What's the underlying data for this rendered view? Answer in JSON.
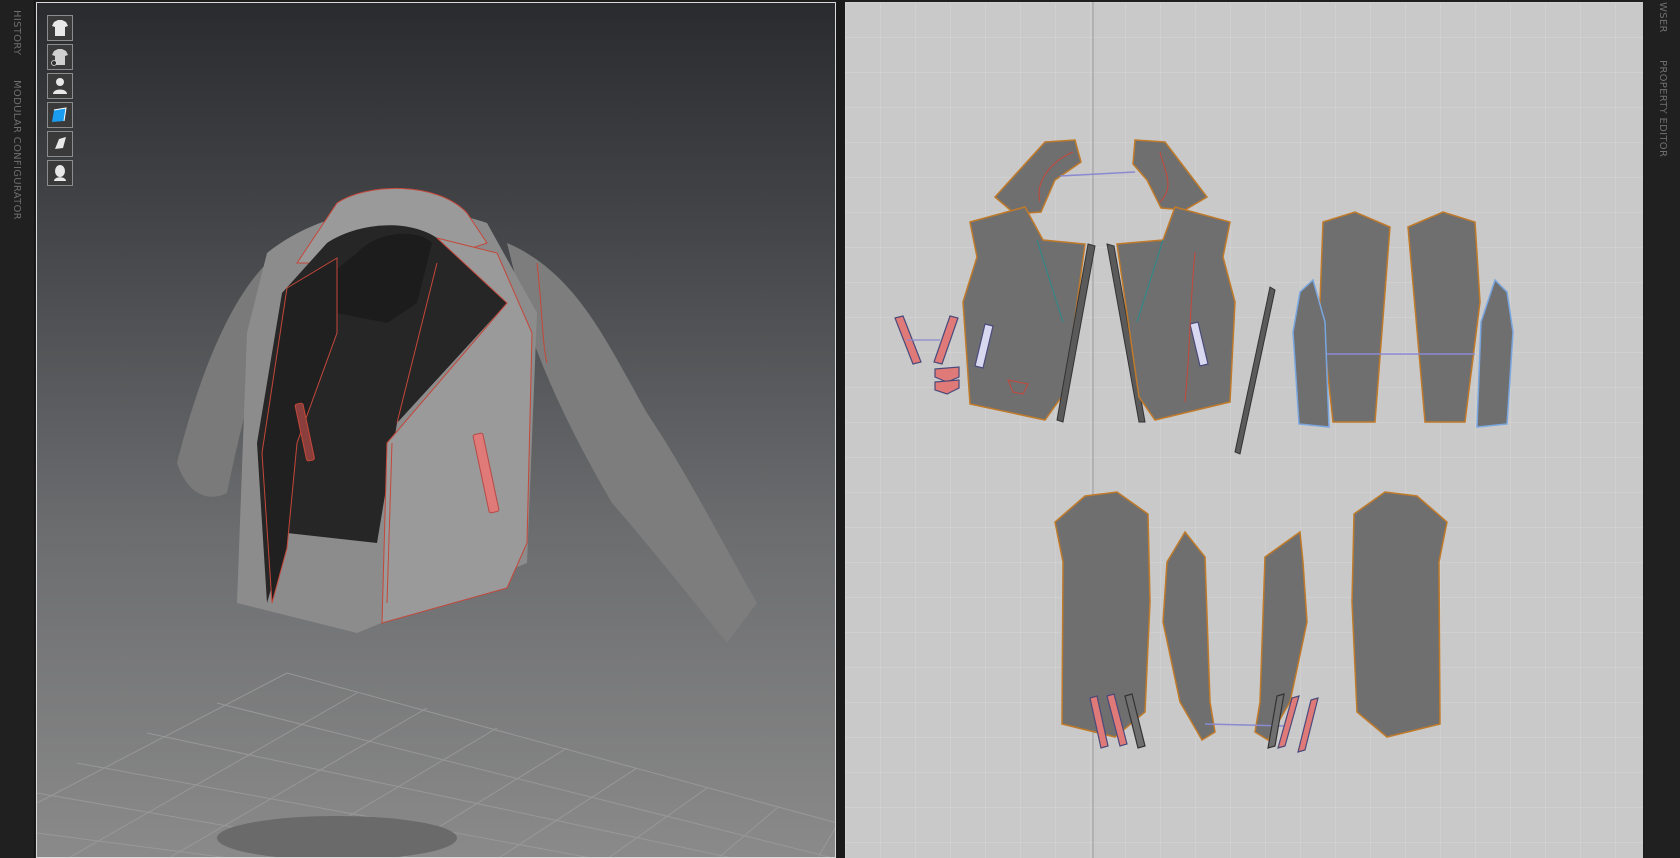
{
  "app": {
    "left_panels": [
      "HISTORY",
      "MODULAR CONFIGURATOR"
    ],
    "right_panels": [
      "WSER",
      "PROPERTY EDITOR"
    ]
  },
  "toolbar": {
    "buttons": [
      {
        "name": "show-garment-icon"
      },
      {
        "name": "garment-solid-icon"
      },
      {
        "name": "show-avatar-icon"
      },
      {
        "name": "texture-display-icon"
      },
      {
        "name": "fabric-display-icon"
      },
      {
        "name": "avatar-display-icon"
      }
    ]
  },
  "colors": {
    "viewport_top": "#2a2b2e",
    "viewport_bottom": "#8a8a8a",
    "garment": "#8e8e8e",
    "lining": "#262626",
    "seam": "#d0463a",
    "pattern_fill": "#707070",
    "pattern_outline": "#c07a2a",
    "accent_selected": "#e07a78",
    "grid2d": "#d8d8d8"
  }
}
